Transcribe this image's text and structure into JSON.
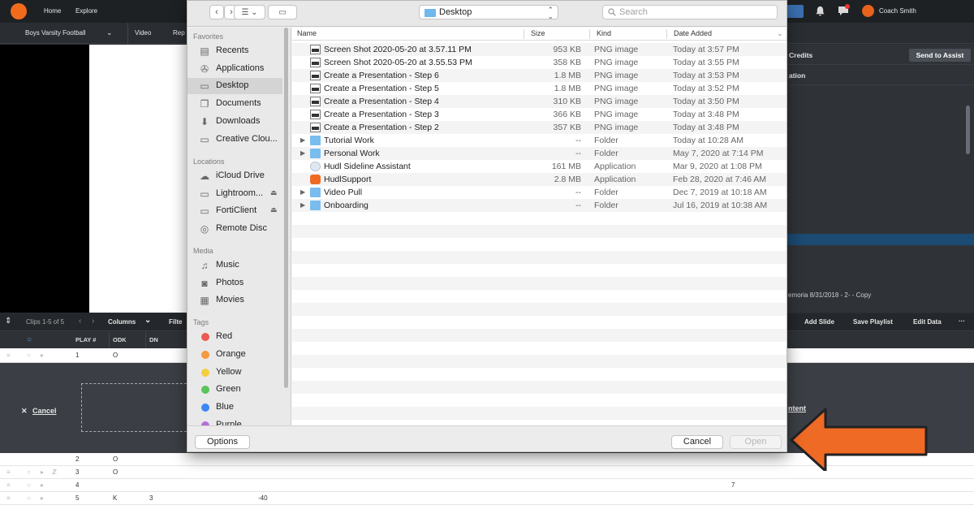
{
  "hudl": {
    "nav_home": "Home",
    "nav_explore": "Explore",
    "coach_name": "Coach Smith",
    "team_name": "Boys Varsity Football",
    "video_tab": "Video",
    "reports_tab": "Rep",
    "credits_label": "Credits",
    "send_to_assist": "Send to Assist",
    "ation_label": "ation",
    "memoria_label": "emoria 8/31/2018 - 2- - Copy",
    "clips_label": "Clips 1-5 of 5",
    "columns_label": "Columns",
    "filter_label": "Filte",
    "add_slide": "Add Slide",
    "save_playlist": "Save Playlist",
    "edit_data": "Edit Data",
    "more": "···",
    "cancel_upload": "Cancel",
    "content_link": "ntent",
    "col_headers": [
      "PLAY #",
      "ODK",
      "DN"
    ],
    "rows": [
      {
        "play": "1",
        "odk": "O",
        "dn": "",
        "extra": "",
        "far": ""
      },
      {
        "play": "2",
        "odk": "O",
        "dn": "",
        "extra": "",
        "far": ""
      },
      {
        "play": "3",
        "odk": "O",
        "dn": "",
        "extra": "",
        "far": ""
      },
      {
        "play": "4",
        "odk": "",
        "dn": "",
        "extra": "",
        "far": "7"
      },
      {
        "play": "5",
        "odk": "K",
        "dn": "3",
        "extra": "-40",
        "far": ""
      }
    ]
  },
  "dialog": {
    "location": "Desktop",
    "search_placeholder": "Search",
    "sections": {
      "favorites": "Favorites",
      "locations": "Locations",
      "media": "Media",
      "tags": "Tags"
    },
    "favorites": [
      {
        "label": "Recents",
        "icon": "recents-icon",
        "selected": false
      },
      {
        "label": "Applications",
        "icon": "applications-icon",
        "selected": false
      },
      {
        "label": "Desktop",
        "icon": "desktop-icon",
        "selected": true
      },
      {
        "label": "Documents",
        "icon": "documents-icon",
        "selected": false
      },
      {
        "label": "Downloads",
        "icon": "downloads-icon",
        "selected": false
      },
      {
        "label": "Creative Clou...",
        "icon": "folder-icon",
        "selected": false
      }
    ],
    "locations": [
      {
        "label": "iCloud Drive",
        "icon": "cloud-icon",
        "eject": false
      },
      {
        "label": "Lightroom...",
        "icon": "drive-icon",
        "eject": true
      },
      {
        "label": "FortiClient",
        "icon": "drive-icon",
        "eject": true
      },
      {
        "label": "Remote Disc",
        "icon": "disc-icon",
        "eject": false
      }
    ],
    "media": [
      {
        "label": "Music",
        "icon": "music-icon"
      },
      {
        "label": "Photos",
        "icon": "photos-icon"
      },
      {
        "label": "Movies",
        "icon": "movies-icon"
      }
    ],
    "tags": [
      {
        "label": "Red",
        "color": "#ec5a52"
      },
      {
        "label": "Orange",
        "color": "#f49a3c"
      },
      {
        "label": "Yellow",
        "color": "#f3cf3e"
      },
      {
        "label": "Green",
        "color": "#5bc45a"
      },
      {
        "label": "Blue",
        "color": "#3d86f5"
      },
      {
        "label": "Purple",
        "color": "#b46fd8"
      }
    ],
    "columns": {
      "name": "Name",
      "size": "Size",
      "kind": "Kind",
      "date": "Date Added"
    },
    "files": [
      {
        "name": "Screen Shot 2020-05-20 at 3.57.11 PM",
        "size": "953 KB",
        "kind": "PNG image",
        "date": "Today at 3:57 PM",
        "type": "png",
        "disclosure": false
      },
      {
        "name": "Screen Shot 2020-05-20 at 3.55.53 PM",
        "size": "358 KB",
        "kind": "PNG image",
        "date": "Today at 3:55 PM",
        "type": "png",
        "disclosure": false
      },
      {
        "name": "Create a Presentation - Step 6",
        "size": "1.8 MB",
        "kind": "PNG image",
        "date": "Today at 3:53 PM",
        "type": "png",
        "disclosure": false
      },
      {
        "name": "Create a Presentation - Step 5",
        "size": "1.8 MB",
        "kind": "PNG image",
        "date": "Today at 3:52 PM",
        "type": "png",
        "disclosure": false
      },
      {
        "name": "Create a Presentation - Step 4",
        "size": "310 KB",
        "kind": "PNG image",
        "date": "Today at 3:50 PM",
        "type": "png",
        "disclosure": false
      },
      {
        "name": "Create a Presentation - Step 3",
        "size": "366 KB",
        "kind": "PNG image",
        "date": "Today at 3:48 PM",
        "type": "png",
        "disclosure": false
      },
      {
        "name": "Create a Presentation - Step 2",
        "size": "357 KB",
        "kind": "PNG image",
        "date": "Today at 3:48 PM",
        "type": "png",
        "disclosure": false
      },
      {
        "name": "Tutorial Work",
        "size": "--",
        "kind": "Folder",
        "date": "Today at 10:28 AM",
        "type": "folder",
        "disclosure": true
      },
      {
        "name": "Personal Work",
        "size": "--",
        "kind": "Folder",
        "date": "May 7, 2020 at 7:14 PM",
        "type": "folder",
        "disclosure": true
      },
      {
        "name": "Hudl Sideline Assistant",
        "size": "161 MB",
        "kind": "Application",
        "date": "Mar 9, 2020 at 1:08 PM",
        "type": "app",
        "disclosure": false
      },
      {
        "name": "HudlSupport",
        "size": "2.8 MB",
        "kind": "Application",
        "date": "Feb 28, 2020 at 7:46 AM",
        "type": "support",
        "disclosure": false
      },
      {
        "name": "Video Pull",
        "size": "--",
        "kind": "Folder",
        "date": "Dec 7, 2019 at 10:18 AM",
        "type": "folder",
        "disclosure": true
      },
      {
        "name": "Onboarding",
        "size": "--",
        "kind": "Folder",
        "date": "Jul 16, 2019 at 10:38 AM",
        "type": "folder",
        "disclosure": true
      }
    ],
    "options_label": "Options",
    "cancel_label": "Cancel",
    "open_label": "Open"
  },
  "annotation": {
    "arrow_color": "#ef6a24"
  }
}
